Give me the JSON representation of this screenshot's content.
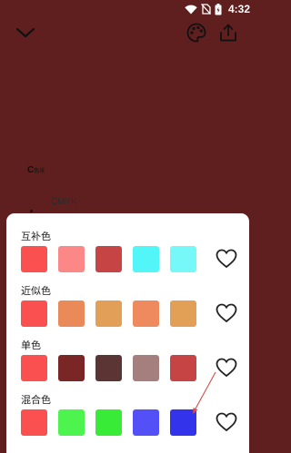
{
  "status_bar": {
    "time": "4:32",
    "icons": [
      "wifi-icon",
      "no-sim-icon",
      "battery-icon"
    ]
  },
  "toolbar": {
    "back_icon": "chevron-down-icon",
    "palette_icon": "palette-icon",
    "share_icon": "share-icon"
  },
  "background": {
    "color": "#5f1f1f",
    "label_c": "C",
    "label_c_small": "色采",
    "label_cmyk": "CMYK"
  },
  "sections": [
    {
      "title": "互补色",
      "colors": [
        "#fa5150",
        "#fb8786",
        "#c64444",
        "#53f6f8",
        "#76f7f8"
      ]
    },
    {
      "title": "近似色",
      "colors": [
        "#fa5150",
        "#ea8a59",
        "#e19f58",
        "#ef8a5e",
        "#e29f56"
      ]
    },
    {
      "title": "单色",
      "colors": [
        "#fa5150",
        "#7b2626",
        "#5b3534",
        "#a57f7d",
        "#c64444"
      ]
    },
    {
      "title": "混合色",
      "colors": [
        "#fa5150",
        "#4ef44e",
        "#37eb37",
        "#5250f6",
        "#3233ea"
      ]
    }
  ],
  "accent": "#e05454"
}
